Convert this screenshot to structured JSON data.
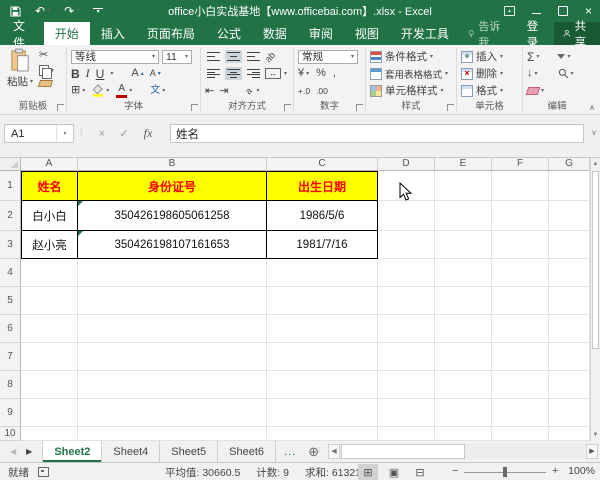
{
  "title_bar": {
    "title": "office小白实战基地【www.officebai.com】.xlsx - Excel"
  },
  "ribbon_tabs": {
    "file": "文件",
    "items": [
      "开始",
      "插入",
      "页面布局",
      "公式",
      "数据",
      "审阅",
      "视图",
      "开发工具"
    ],
    "active": "开始",
    "tell_me": "告诉我...",
    "sign_in": "登录",
    "share": "共享"
  },
  "ribbon": {
    "clipboard": {
      "group_label": "剪贴板",
      "paste_label": "粘贴"
    },
    "font": {
      "group_label": "字体",
      "font_name": "等线",
      "font_size": "11",
      "bold": "B",
      "italic": "I",
      "underline": "U",
      "grow": "A",
      "shrink": "A",
      "font_color_letter": "A",
      "phonetic": "文"
    },
    "alignment": {
      "group_label": "对齐方式",
      "orientation_glyph": "ab"
    },
    "number": {
      "group_label": "数字",
      "format": "常规",
      "currency": "¥",
      "percent": "%",
      "comma": ",",
      "inc_decimal": "+.0",
      "dec_decimal": ".00"
    },
    "styles": {
      "group_label": "样式",
      "conditional": "条件格式",
      "format_table": "套用表格格式",
      "cell_styles": "单元格样式"
    },
    "cells": {
      "group_label": "单元格",
      "insert": "插入",
      "delete": "删除",
      "format": "格式"
    },
    "editing": {
      "group_label": "编辑",
      "autosum": "Σ"
    }
  },
  "formula_bar": {
    "name_box": "A1",
    "fx_label": "fx",
    "content": "姓名"
  },
  "grid": {
    "column_headers": [
      "A",
      "B",
      "C",
      "D",
      "E",
      "F",
      "G"
    ],
    "row_headers": [
      "1",
      "2",
      "3",
      "4",
      "5",
      "6",
      "7",
      "8",
      "9",
      "10"
    ],
    "table": {
      "header_row": [
        "姓名",
        "身份证号",
        "出生日期"
      ],
      "rows": [
        {
          "cells": [
            "白小白",
            "350426198605061258",
            "1986/5/6"
          ],
          "error_flags": [
            false,
            true,
            false
          ]
        },
        {
          "cells": [
            "赵小亮",
            "350426198107161653",
            "1981/7/16"
          ],
          "error_flags": [
            false,
            true,
            false
          ]
        }
      ]
    }
  },
  "sheet_bar": {
    "tabs": [
      {
        "label": "Sheet2",
        "active": true
      },
      {
        "label": "Sheet4",
        "active": false
      },
      {
        "label": "Sheet5",
        "active": false
      },
      {
        "label": "Sheet6",
        "active": false
      }
    ],
    "overflow": "..."
  },
  "status_bar": {
    "mode": "就绪",
    "stats": [
      "平均值: 30660.5",
      "计数: 9",
      "求和: 61321"
    ],
    "zoom_level": "100%"
  },
  "colors": {
    "excel_green": "#217346",
    "table_header_bg": "#FFFF00",
    "table_header_text": "#FF0000",
    "error_flag_green": "#1E7145",
    "font_color_red": "#C00000",
    "fill_color_yellow": "#FFFF00"
  },
  "icons": {
    "save": "floppy",
    "undo": "↶",
    "redo": "↷",
    "cut": "✂",
    "copy": "double-rect",
    "format_painter": "brush",
    "borders": "⊞",
    "fill_color": "bucket+yellow-bar",
    "font_color": "A+red-bar",
    "sort_filter": "funnel",
    "find": "magnifier",
    "clear": "eraser",
    "fill_down": "↓",
    "new_sheet": "⊕",
    "tell_me": "lightbulb",
    "share": "person",
    "close": "×",
    "minimize": "–",
    "maximize": "□",
    "formula_cancel": "×",
    "formula_confirm": "✓",
    "error_flag": "green-corner-triangle"
  }
}
